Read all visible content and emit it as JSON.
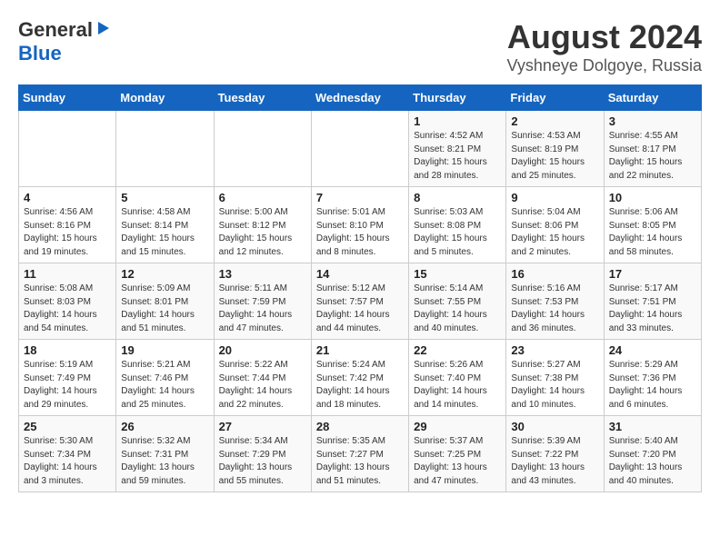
{
  "logo": {
    "line1": "General",
    "line2": "Blue"
  },
  "title": "August 2024",
  "subtitle": "Vyshneye Dolgoye, Russia",
  "days_of_week": [
    "Sunday",
    "Monday",
    "Tuesday",
    "Wednesday",
    "Thursday",
    "Friday",
    "Saturday"
  ],
  "weeks": [
    [
      {
        "day": "",
        "info": ""
      },
      {
        "day": "",
        "info": ""
      },
      {
        "day": "",
        "info": ""
      },
      {
        "day": "",
        "info": ""
      },
      {
        "day": "1",
        "info": "Sunrise: 4:52 AM\nSunset: 8:21 PM\nDaylight: 15 hours\nand 28 minutes."
      },
      {
        "day": "2",
        "info": "Sunrise: 4:53 AM\nSunset: 8:19 PM\nDaylight: 15 hours\nand 25 minutes."
      },
      {
        "day": "3",
        "info": "Sunrise: 4:55 AM\nSunset: 8:17 PM\nDaylight: 15 hours\nand 22 minutes."
      }
    ],
    [
      {
        "day": "4",
        "info": "Sunrise: 4:56 AM\nSunset: 8:16 PM\nDaylight: 15 hours\nand 19 minutes."
      },
      {
        "day": "5",
        "info": "Sunrise: 4:58 AM\nSunset: 8:14 PM\nDaylight: 15 hours\nand 15 minutes."
      },
      {
        "day": "6",
        "info": "Sunrise: 5:00 AM\nSunset: 8:12 PM\nDaylight: 15 hours\nand 12 minutes."
      },
      {
        "day": "7",
        "info": "Sunrise: 5:01 AM\nSunset: 8:10 PM\nDaylight: 15 hours\nand 8 minutes."
      },
      {
        "day": "8",
        "info": "Sunrise: 5:03 AM\nSunset: 8:08 PM\nDaylight: 15 hours\nand 5 minutes."
      },
      {
        "day": "9",
        "info": "Sunrise: 5:04 AM\nSunset: 8:06 PM\nDaylight: 15 hours\nand 2 minutes."
      },
      {
        "day": "10",
        "info": "Sunrise: 5:06 AM\nSunset: 8:05 PM\nDaylight: 14 hours\nand 58 minutes."
      }
    ],
    [
      {
        "day": "11",
        "info": "Sunrise: 5:08 AM\nSunset: 8:03 PM\nDaylight: 14 hours\nand 54 minutes."
      },
      {
        "day": "12",
        "info": "Sunrise: 5:09 AM\nSunset: 8:01 PM\nDaylight: 14 hours\nand 51 minutes."
      },
      {
        "day": "13",
        "info": "Sunrise: 5:11 AM\nSunset: 7:59 PM\nDaylight: 14 hours\nand 47 minutes."
      },
      {
        "day": "14",
        "info": "Sunrise: 5:12 AM\nSunset: 7:57 PM\nDaylight: 14 hours\nand 44 minutes."
      },
      {
        "day": "15",
        "info": "Sunrise: 5:14 AM\nSunset: 7:55 PM\nDaylight: 14 hours\nand 40 minutes."
      },
      {
        "day": "16",
        "info": "Sunrise: 5:16 AM\nSunset: 7:53 PM\nDaylight: 14 hours\nand 36 minutes."
      },
      {
        "day": "17",
        "info": "Sunrise: 5:17 AM\nSunset: 7:51 PM\nDaylight: 14 hours\nand 33 minutes."
      }
    ],
    [
      {
        "day": "18",
        "info": "Sunrise: 5:19 AM\nSunset: 7:49 PM\nDaylight: 14 hours\nand 29 minutes."
      },
      {
        "day": "19",
        "info": "Sunrise: 5:21 AM\nSunset: 7:46 PM\nDaylight: 14 hours\nand 25 minutes."
      },
      {
        "day": "20",
        "info": "Sunrise: 5:22 AM\nSunset: 7:44 PM\nDaylight: 14 hours\nand 22 minutes."
      },
      {
        "day": "21",
        "info": "Sunrise: 5:24 AM\nSunset: 7:42 PM\nDaylight: 14 hours\nand 18 minutes."
      },
      {
        "day": "22",
        "info": "Sunrise: 5:26 AM\nSunset: 7:40 PM\nDaylight: 14 hours\nand 14 minutes."
      },
      {
        "day": "23",
        "info": "Sunrise: 5:27 AM\nSunset: 7:38 PM\nDaylight: 14 hours\nand 10 minutes."
      },
      {
        "day": "24",
        "info": "Sunrise: 5:29 AM\nSunset: 7:36 PM\nDaylight: 14 hours\nand 6 minutes."
      }
    ],
    [
      {
        "day": "25",
        "info": "Sunrise: 5:30 AM\nSunset: 7:34 PM\nDaylight: 14 hours\nand 3 minutes."
      },
      {
        "day": "26",
        "info": "Sunrise: 5:32 AM\nSunset: 7:31 PM\nDaylight: 13 hours\nand 59 minutes."
      },
      {
        "day": "27",
        "info": "Sunrise: 5:34 AM\nSunset: 7:29 PM\nDaylight: 13 hours\nand 55 minutes."
      },
      {
        "day": "28",
        "info": "Sunrise: 5:35 AM\nSunset: 7:27 PM\nDaylight: 13 hours\nand 51 minutes."
      },
      {
        "day": "29",
        "info": "Sunrise: 5:37 AM\nSunset: 7:25 PM\nDaylight: 13 hours\nand 47 minutes."
      },
      {
        "day": "30",
        "info": "Sunrise: 5:39 AM\nSunset: 7:22 PM\nDaylight: 13 hours\nand 43 minutes."
      },
      {
        "day": "31",
        "info": "Sunrise: 5:40 AM\nSunset: 7:20 PM\nDaylight: 13 hours\nand 40 minutes."
      }
    ]
  ]
}
